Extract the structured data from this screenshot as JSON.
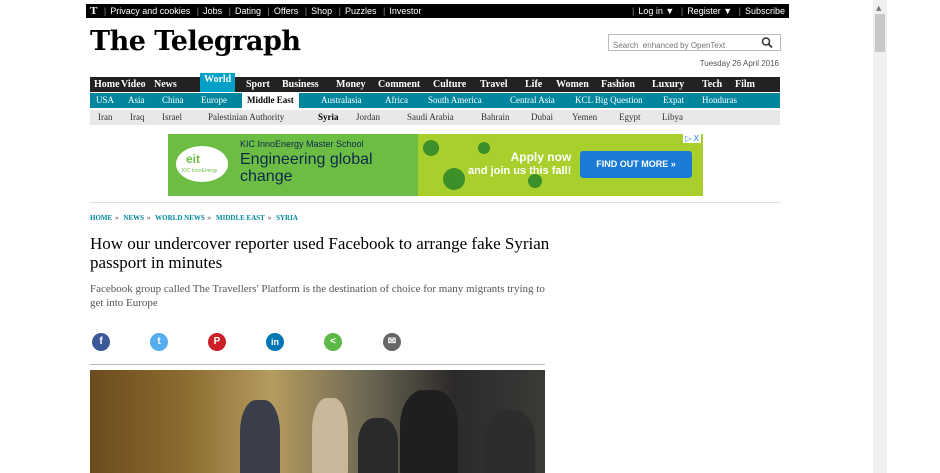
{
  "topbar": {
    "logo": "T",
    "left_links": [
      "Privacy and cookies",
      "Jobs",
      "Dating",
      "Offers",
      "Shop",
      "Puzzles",
      "Investor"
    ],
    "login": "Log in ▼",
    "register": "Register ▼",
    "subscribe": "Subscribe"
  },
  "masthead": {
    "title": "The Telegraph"
  },
  "search": {
    "placeholder": "Search  enhanced by OpenText"
  },
  "date": "Tuesday 26 April 2016",
  "nav_main": [
    "Home",
    "Video",
    "News",
    "World",
    "Sport",
    "Business",
    "Money",
    "Comment",
    "Culture",
    "Travel",
    "Life",
    "Women",
    "Fashion",
    "Luxury",
    "Tech",
    "Film"
  ],
  "nav_region": [
    "USA",
    "Asia",
    "China",
    "Europe",
    "Middle East",
    "Australasia",
    "Africa",
    "South America",
    "Central Asia",
    "KCL Big Question",
    "Expat",
    "Honduras"
  ],
  "nav_country": [
    "Iran",
    "Iraq",
    "Israel",
    "Palestinian Authority",
    "Syria",
    "Jordan",
    "Saudi Arabia",
    "Bahrain",
    "Dubai",
    "Yemen",
    "Egypt",
    "Libya"
  ],
  "ad": {
    "school": "KIC InnoEnergy Master School",
    "headline_line1": "Engineering global",
    "headline_line2": "change",
    "apply_line1": "Apply now",
    "apply_line2": "and join us this fall!",
    "cta": "FIND OUT MORE  »",
    "logo_text": "eit",
    "logo_sub": "KIC InnoEnergy",
    "close": "▷ X"
  },
  "breadcrumb": [
    "HOME",
    "NEWS",
    "WORLD NEWS",
    "MIDDLE EAST",
    "SYRIA"
  ],
  "article": {
    "headline": "How our undercover reporter used Facebook to arrange fake Syrian passport in minutes",
    "standfirst": "Facebook group called The Travellers' Platform is the destination of choice for many migrants trying to get into Europe"
  },
  "share": {
    "facebook": "f",
    "twitter": "t",
    "pinterest": "P",
    "linkedin": "in",
    "share": "<",
    "email": "✉"
  },
  "colors": {
    "nav_dark": "#222222",
    "world_accent": "#00a1c7",
    "region_bar": "#00879e",
    "facebook": "#3b5998",
    "twitter": "#55acee",
    "pinterest": "#cb2027",
    "linkedin": "#0077b5",
    "sharethis": "#5cb947",
    "email": "#666666"
  }
}
